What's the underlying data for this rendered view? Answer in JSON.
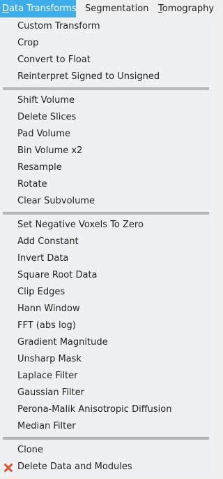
{
  "menubar": {
    "items": [
      {
        "label_pre": "",
        "mnemonic": "D",
        "label_post": "ata Transforms"
      },
      {
        "label_pre": "Se",
        "mnemonic": "g",
        "label_post": "mentation"
      },
      {
        "label_pre": "",
        "mnemonic": "T",
        "label_post": "omography"
      }
    ]
  },
  "menu": {
    "groups": [
      {
        "items": [
          "Custom Transform",
          "Crop",
          "Convert to Float",
          "Reinterpret Signed to Unsigned"
        ]
      },
      {
        "items": [
          "Shift Volume",
          "Delete Slices",
          "Pad Volume",
          "Bin Volume x2",
          "Resample",
          "Rotate",
          "Clear Subvolume"
        ]
      },
      {
        "items": [
          "Set Negative Voxels To Zero",
          "Add Constant",
          "Invert Data",
          "Square Root Data",
          "Clip Edges",
          "Hann Window",
          "FFT (abs log)",
          "Gradient Magnitude",
          "Unsharp Mask",
          "Laplace Filter",
          "Gaussian Filter",
          "Perona-Malik Anisotropic Diffusion",
          "Median Filter"
        ]
      },
      {
        "items": [
          "Clone",
          "Delete Data and Modules"
        ]
      }
    ],
    "delete_icon": "red-x-icon",
    "delete_icon_color": "#e0502c"
  },
  "colors": {
    "highlight": "#3daee9",
    "background": "#eff0f1"
  }
}
